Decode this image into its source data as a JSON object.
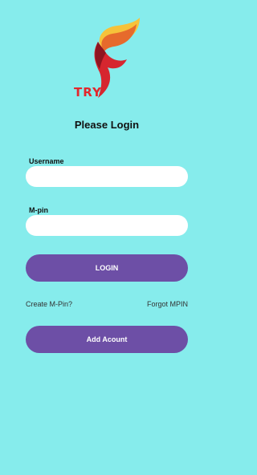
{
  "logo": {
    "text": "TRY",
    "colors": [
      "#f6c23a",
      "#e66a2c",
      "#d6262f",
      "#8e1520"
    ]
  },
  "login": {
    "title": "Please Login",
    "username_label": "Username",
    "username_value": "",
    "mpin_label": "M-pin",
    "mpin_value": "",
    "login_button": "LOGIN",
    "create_mpin": "Create M-Pin?",
    "forgot_mpin": "Forgot MPIN",
    "add_account_button": "Add Acount"
  },
  "colors": {
    "background": "#86ecec",
    "button": "#6d4fa6",
    "field": "#ffffff"
  }
}
